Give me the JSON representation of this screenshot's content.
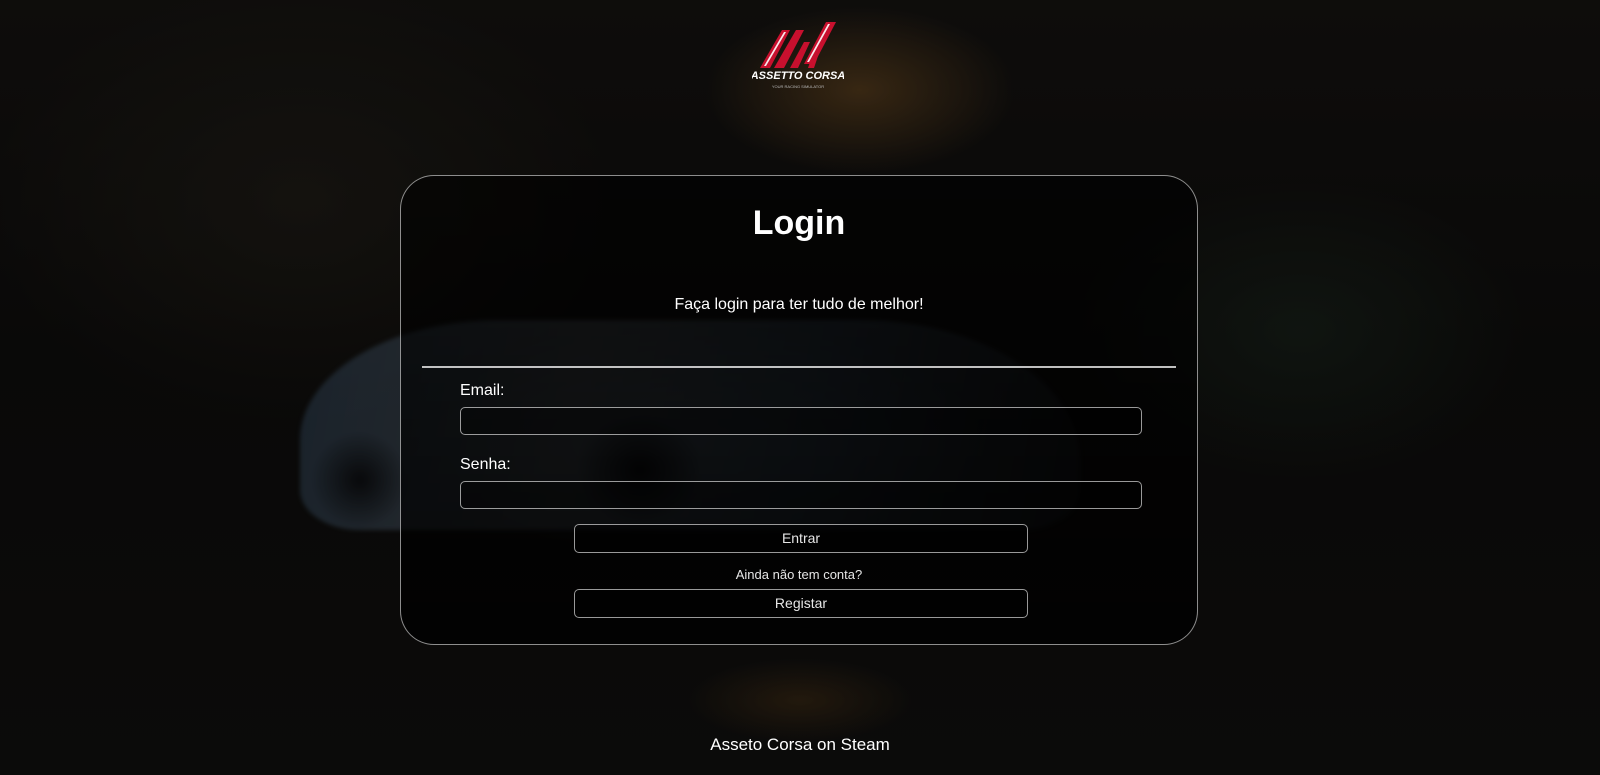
{
  "brand": {
    "logo_text": "ASSETTO CORSA",
    "logo_tagline": "YOUR RACING SIMULATOR",
    "logo_color": "#c8102e"
  },
  "login": {
    "title": "Login",
    "subtitle": "Faça login para ter tudo de melhor!",
    "email_label": "Email:",
    "email_value": "",
    "password_label": "Senha:",
    "password_value": "",
    "submit_label": "Entrar",
    "no_account_text": "Ainda não tem conta?",
    "register_label": "Registar"
  },
  "footer": {
    "steam_link": "Asseto Corsa on Steam"
  }
}
